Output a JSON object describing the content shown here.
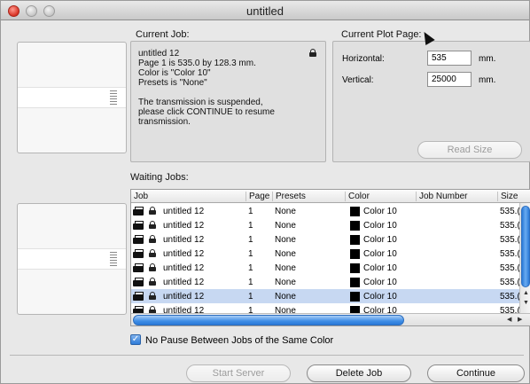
{
  "window": {
    "title": "untitled"
  },
  "current_job": {
    "label": "Current Job:",
    "lines": [
      "untitled 12",
      "Page 1 is 535.0 by 128.3 mm.",
      "Color is \"Color 10\"",
      "Presets is \"None\""
    ],
    "message": [
      "The transmission is suspended,",
      "please click CONTINUE to resume",
      "transmission."
    ]
  },
  "plot_page": {
    "label": "Current Plot Page:",
    "horizontal_label": "Horizontal:",
    "horizontal_value": "535",
    "vertical_label": "Vertical:",
    "vertical_value": "25000",
    "unit": "mm.",
    "read_size_label": "Read Size"
  },
  "waiting": {
    "label": "Waiting Jobs:",
    "columns": [
      "Job",
      "Page",
      "Presets",
      "Color",
      "Job Number",
      "Size"
    ],
    "rows": [
      {
        "job": "untitled 12",
        "page": "1",
        "presets": "None",
        "color": "Color 10",
        "size": "535.("
      },
      {
        "job": "untitled 12",
        "page": "1",
        "presets": "None",
        "color": "Color 10",
        "size": "535.("
      },
      {
        "job": "untitled 12",
        "page": "1",
        "presets": "None",
        "color": "Color 10",
        "size": "535.("
      },
      {
        "job": "untitled 12",
        "page": "1",
        "presets": "None",
        "color": "Color 10",
        "size": "535.("
      },
      {
        "job": "untitled 12",
        "page": "1",
        "presets": "None",
        "color": "Color 10",
        "size": "535.("
      },
      {
        "job": "untitled 12",
        "page": "1",
        "presets": "None",
        "color": "Color 10",
        "size": "535.("
      },
      {
        "job": "untitled 12",
        "page": "1",
        "presets": "None",
        "color": "Color 10",
        "size": "535.("
      },
      {
        "job": "untitled 12",
        "page": "1",
        "presets": "None",
        "color": "Color 10",
        "size": "535.("
      }
    ],
    "selected_row": 6
  },
  "options": {
    "no_pause_label": "No Pause Between Jobs of the Same Color",
    "no_pause_checked": true
  },
  "buttons": {
    "start_server": "Start Server",
    "delete_job": "Delete Job",
    "continue": "Continue"
  },
  "colors": {
    "selection": "#c7d8f2",
    "scroll_blue": "#3f8ee6"
  },
  "icons": [
    "close-button",
    "minimize-button",
    "zoom-button",
    "lock-icon",
    "printer-icon",
    "color-swatch",
    "checkbox-checked"
  ]
}
